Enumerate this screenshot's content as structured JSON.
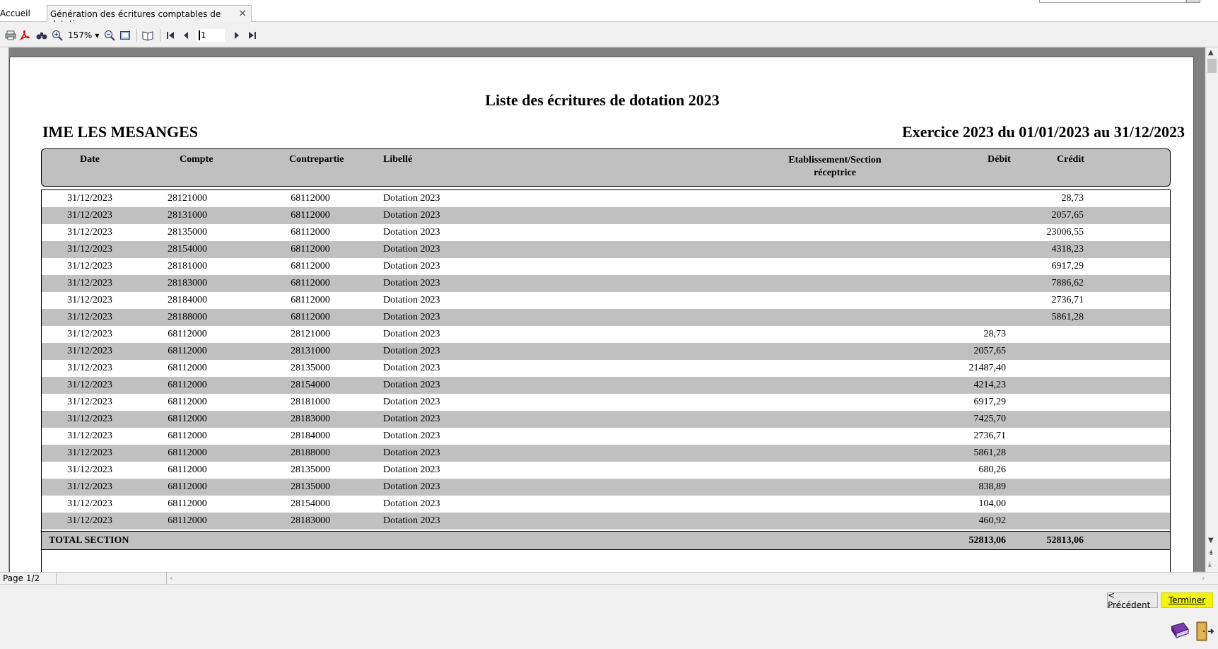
{
  "tabs": {
    "home": "Accueil",
    "active": "Génération des écritures comptables de dotation",
    "close_glyph": "×"
  },
  "toolbar": {
    "zoom": "157%",
    "page_number": "1",
    "icons": [
      "print-icon",
      "pdf-icon",
      "binoculars-icon",
      "zoom-in-icon",
      "zoom-out-icon",
      "fit-page-icon",
      "book-icon",
      "first-page-icon",
      "previous-page-icon",
      "next-page-icon",
      "last-page-icon"
    ]
  },
  "report": {
    "title": "Liste des écritures de dotation 2023",
    "entity": "IME LES MESANGES",
    "exercise": "Exercice 2023 du 01/01/2023 au 31/12/2023",
    "columns": {
      "date": "Date",
      "compte": "Compte",
      "contrepartie": "Contrepartie",
      "libelle": "Libellé",
      "etab_line1": "Etablissement/Section",
      "etab_line2": "réceptrice",
      "debit": "Débit",
      "credit": "Crédit"
    },
    "rows": [
      {
        "date": "31/12/2023",
        "compte": "28121000",
        "contrepartie": "68112000",
        "libelle": "Dotation 2023",
        "debit": "",
        "credit": "28,73"
      },
      {
        "date": "31/12/2023",
        "compte": "28131000",
        "contrepartie": "68112000",
        "libelle": "Dotation 2023",
        "debit": "",
        "credit": "2057,65"
      },
      {
        "date": "31/12/2023",
        "compte": "28135000",
        "contrepartie": "68112000",
        "libelle": "Dotation 2023",
        "debit": "",
        "credit": "23006,55"
      },
      {
        "date": "31/12/2023",
        "compte": "28154000",
        "contrepartie": "68112000",
        "libelle": "Dotation 2023",
        "debit": "",
        "credit": "4318,23"
      },
      {
        "date": "31/12/2023",
        "compte": "28181000",
        "contrepartie": "68112000",
        "libelle": "Dotation 2023",
        "debit": "",
        "credit": "6917,29"
      },
      {
        "date": "31/12/2023",
        "compte": "28183000",
        "contrepartie": "68112000",
        "libelle": "Dotation 2023",
        "debit": "",
        "credit": "7886,62"
      },
      {
        "date": "31/12/2023",
        "compte": "28184000",
        "contrepartie": "68112000",
        "libelle": "Dotation 2023",
        "debit": "",
        "credit": "2736,71"
      },
      {
        "date": "31/12/2023",
        "compte": "28188000",
        "contrepartie": "68112000",
        "libelle": "Dotation 2023",
        "debit": "",
        "credit": "5861,28"
      },
      {
        "date": "31/12/2023",
        "compte": "68112000",
        "contrepartie": "28121000",
        "libelle": "Dotation 2023",
        "debit": "28,73",
        "credit": ""
      },
      {
        "date": "31/12/2023",
        "compte": "68112000",
        "contrepartie": "28131000",
        "libelle": "Dotation 2023",
        "debit": "2057,65",
        "credit": ""
      },
      {
        "date": "31/12/2023",
        "compte": "68112000",
        "contrepartie": "28135000",
        "libelle": "Dotation 2023",
        "debit": "21487,40",
        "credit": ""
      },
      {
        "date": "31/12/2023",
        "compte": "68112000",
        "contrepartie": "28154000",
        "libelle": "Dotation 2023",
        "debit": "4214,23",
        "credit": ""
      },
      {
        "date": "31/12/2023",
        "compte": "68112000",
        "contrepartie": "28181000",
        "libelle": "Dotation 2023",
        "debit": "6917,29",
        "credit": ""
      },
      {
        "date": "31/12/2023",
        "compte": "68112000",
        "contrepartie": "28183000",
        "libelle": "Dotation 2023",
        "debit": "7425,70",
        "credit": ""
      },
      {
        "date": "31/12/2023",
        "compte": "68112000",
        "contrepartie": "28184000",
        "libelle": "Dotation 2023",
        "debit": "2736,71",
        "credit": ""
      },
      {
        "date": "31/12/2023",
        "compte": "68112000",
        "contrepartie": "28188000",
        "libelle": "Dotation 2023",
        "debit": "5861,28",
        "credit": ""
      },
      {
        "date": "31/12/2023",
        "compte": "68112000",
        "contrepartie": "28135000",
        "libelle": "Dotation 2023",
        "debit": "680,26",
        "credit": ""
      },
      {
        "date": "31/12/2023",
        "compte": "68112000",
        "contrepartie": "28135000",
        "libelle": "Dotation 2023",
        "debit": "838,89",
        "credit": ""
      },
      {
        "date": "31/12/2023",
        "compte": "68112000",
        "contrepartie": "28154000",
        "libelle": "Dotation 2023",
        "debit": "104,00",
        "credit": ""
      },
      {
        "date": "31/12/2023",
        "compte": "68112000",
        "contrepartie": "28183000",
        "libelle": "Dotation 2023",
        "debit": "460,92",
        "credit": ""
      }
    ],
    "total": {
      "label": "TOTAL SECTION",
      "debit": "52813,06",
      "credit": "52813,06"
    }
  },
  "status": {
    "page": "Page 1/2"
  },
  "buttons": {
    "previous": "< Précédent",
    "finish": "Terminer"
  },
  "colors": {
    "row_alt": "#c0c0c0",
    "highlight": "#f4f40a",
    "preview_bg": "#808080"
  }
}
